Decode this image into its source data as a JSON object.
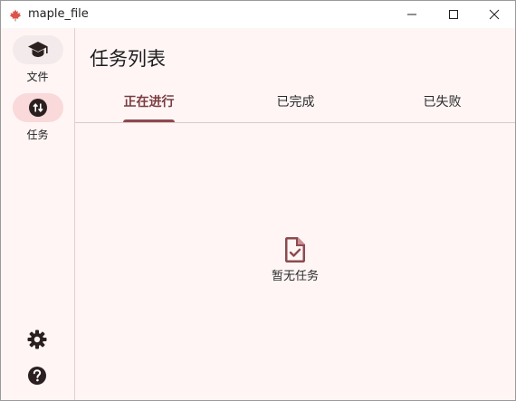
{
  "window": {
    "title": "maple_file",
    "icons": {
      "app": "maple-leaf-icon",
      "minimize": "minimize-icon",
      "maximize": "maximize-icon",
      "close": "close-icon"
    }
  },
  "sidebar": {
    "items": [
      {
        "label": "文件",
        "icon": "graduation-cap-icon",
        "active": false
      },
      {
        "label": "任务",
        "icon": "swap-vertical-icon",
        "active": true
      }
    ],
    "bottom_icons": [
      "gear-icon",
      "help-icon"
    ]
  },
  "main": {
    "title": "任务列表",
    "tabs": [
      {
        "label": "正在进行",
        "active": true
      },
      {
        "label": "已完成",
        "active": false
      },
      {
        "label": "已失败",
        "active": false
      }
    ],
    "empty_state": {
      "icon": "file-check-icon",
      "text": "暂无任务"
    }
  },
  "colors": {
    "accent": "#8d4a4e",
    "background": "#fff5f5",
    "nav_active": "#f9d9d9",
    "app_icon": "#d9534f"
  }
}
